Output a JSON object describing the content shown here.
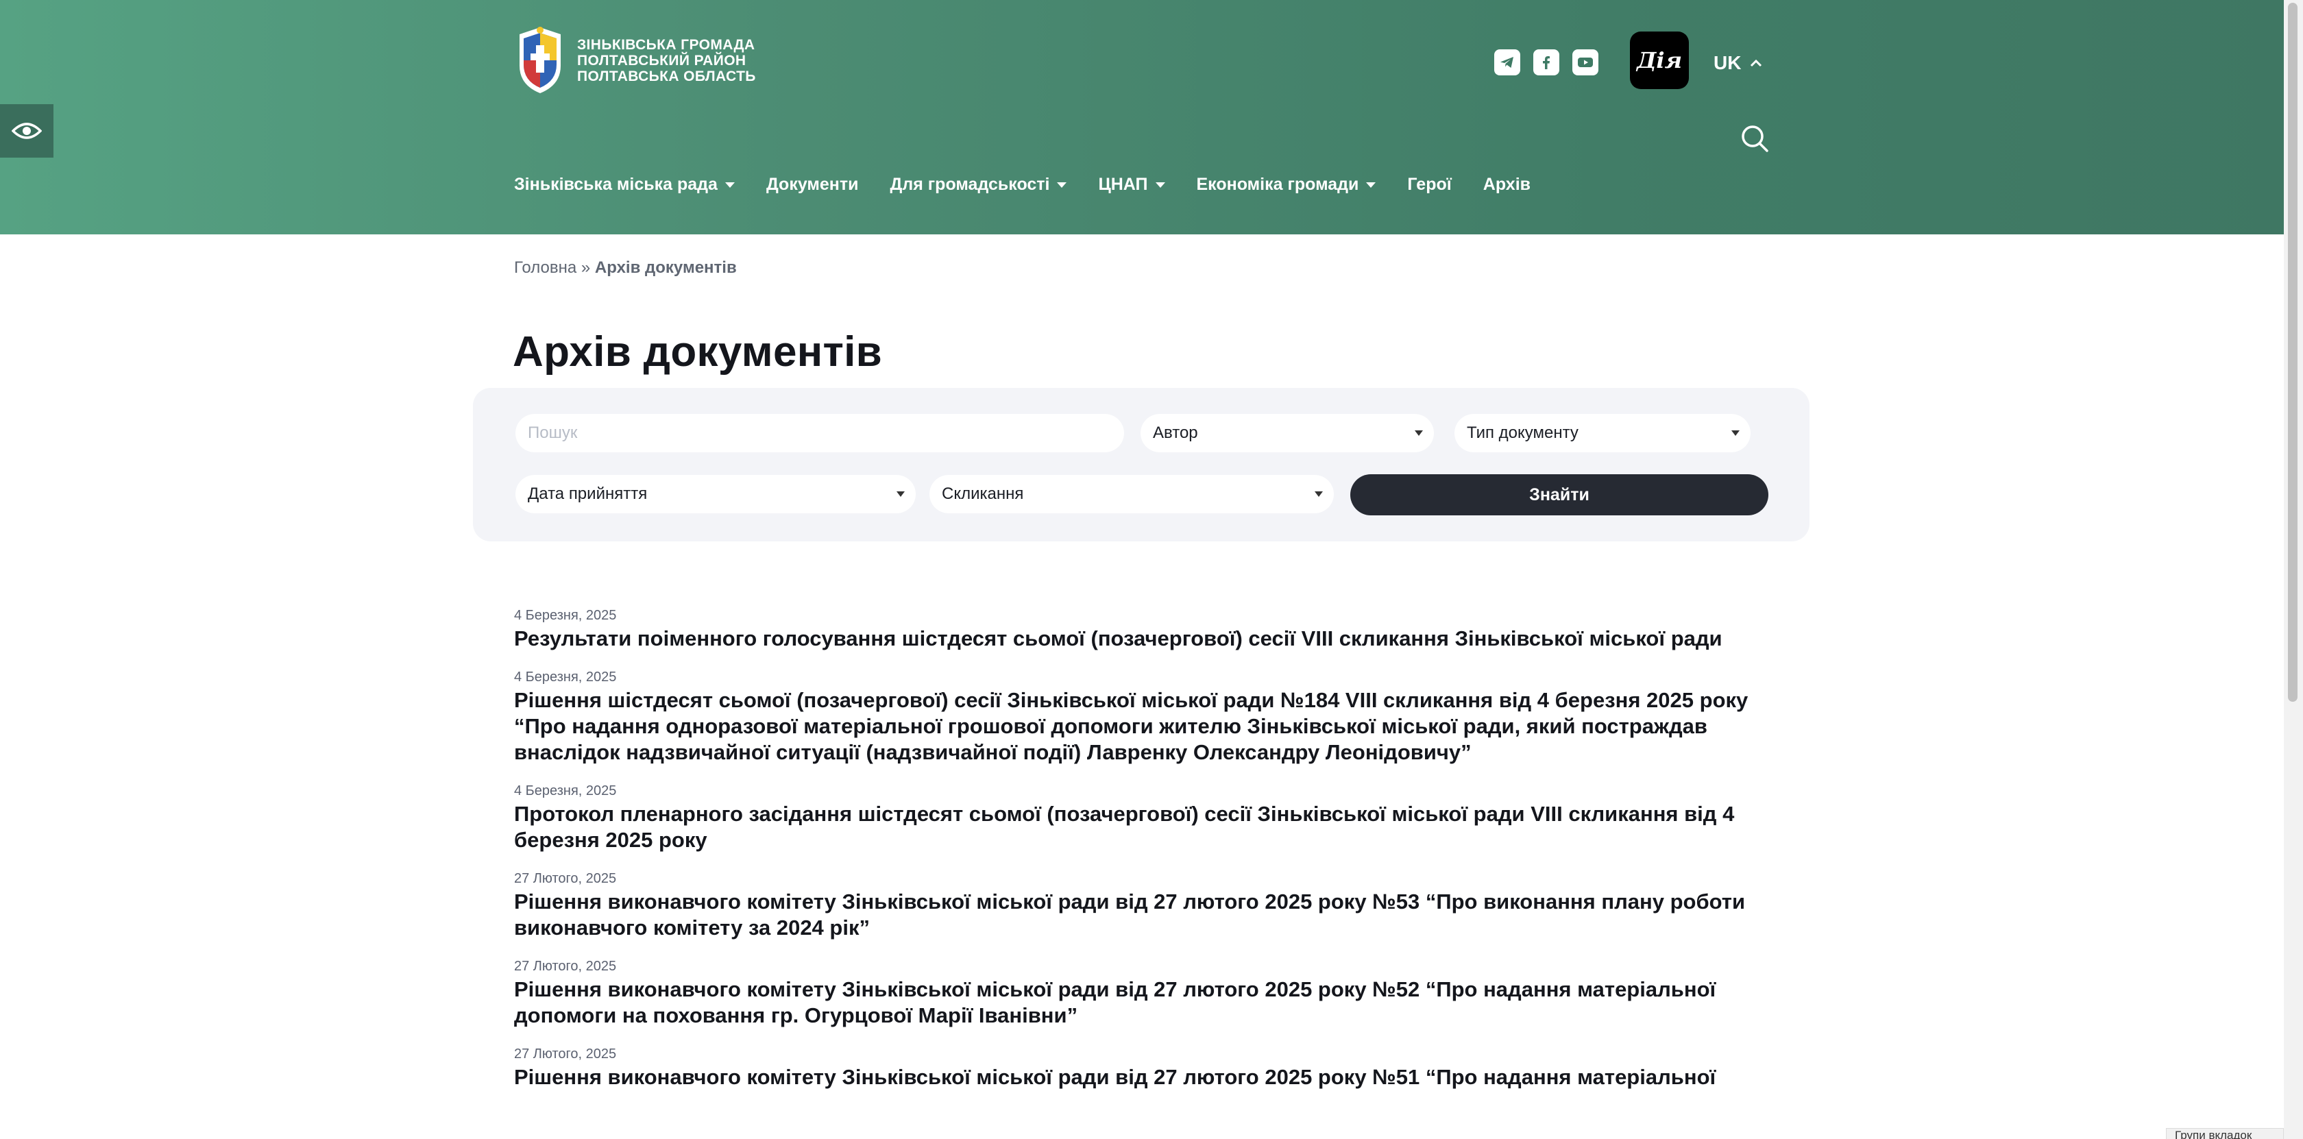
{
  "header": {
    "logo_lines": [
      "ЗІНЬКІВСЬКА ГРОМАДА",
      "ПОЛТАВСЬКИЙ РАЙОН",
      "ПОЛТАВСЬКА ОБЛАСТЬ"
    ],
    "socials": [
      "telegram-icon",
      "facebook-icon",
      "youtube-icon"
    ],
    "diia_label": "Дія",
    "lang": "UK",
    "colors": {
      "gradient_start": "#56a283",
      "gradient_end": "#3f7763"
    }
  },
  "nav": {
    "items": [
      {
        "label": "Зіньківська міська рада",
        "dropdown": true
      },
      {
        "label": "Документи",
        "dropdown": false
      },
      {
        "label": "Для громадськості",
        "dropdown": true
      },
      {
        "label": "ЦНАП",
        "dropdown": true
      },
      {
        "label": "Економіка громади",
        "dropdown": true
      },
      {
        "label": "Герої",
        "dropdown": false
      },
      {
        "label": "Архів",
        "dropdown": false
      }
    ]
  },
  "breadcrumb": {
    "home": "Головна",
    "separator": "»",
    "current": "Архів документів"
  },
  "page_title": "Архів документів",
  "filters": {
    "search_placeholder": "Пошук",
    "author": "Автор",
    "doc_type": "Тип документу",
    "date": "Дата прийняття",
    "convocation": "Скликання",
    "find_button": "Знайти"
  },
  "documents": [
    {
      "date": "4 Березня, 2025",
      "title": "Результати поіменного голосування шістдесят сьомої (позачергової) сесії VIII скликання Зіньківської міської ради"
    },
    {
      "date": "4 Березня, 2025",
      "title": "Рішення шістдесят сьомої (позачергової) сесії Зіньківської міської ради №184 VIII скликання від 4 березня 2025 року “Про надання одноразової матеріальної грошової допомоги жителю Зіньківської міської ради, який постраждав внаслідок надзвичайної ситуації (надзвичайної події) Лавренку Олександру Леонідовичу”"
    },
    {
      "date": "4 Березня, 2025",
      "title": "Протокол пленарного засідання шістдесят сьомої (позачергової) сесії Зіньківської міської ради VIII скликання від 4 березня 2025 року"
    },
    {
      "date": "27 Лютого, 2025",
      "title": "Рішення виконавчого комітету Зіньківської міської ради від 27 лютого 2025 року №53 “Про виконання плану роботи виконавчого комітету за 2024 рік”"
    },
    {
      "date": "27 Лютого, 2025",
      "title": "Рішення виконавчого комітету Зіньківської міської ради від 27 лютого 2025 року №52 “Про надання матеріальної допомоги на поховання гр. Огурцової Марії Іванівни”"
    },
    {
      "date": "27 Лютого, 2025",
      "title": "Рішення виконавчого комітету Зіньківської міської ради від 27 лютого 2025 року №51 “Про надання матеріальної"
    }
  ],
  "bottom_tab": "Групи вкладок"
}
